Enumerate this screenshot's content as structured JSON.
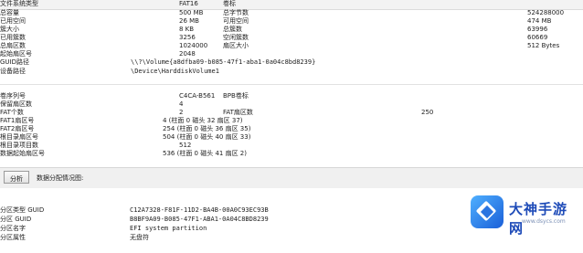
{
  "properties": [
    {
      "label": "文件系统类型",
      "value1": "FAT16",
      "label2": "卷标",
      "value2": ""
    },
    {
      "label": "总容量",
      "value1": "500 MB",
      "label2": "总字节数",
      "value2": "524288000"
    },
    {
      "label": "已用空间",
      "value1": "26 MB",
      "label2": "可用空间",
      "value2": "474 MB"
    },
    {
      "label": "簇大小",
      "value1": "8 KB",
      "label2": "总簇数",
      "value2": "63996"
    },
    {
      "label": "已用簇数",
      "value1": "3256",
      "label2": "空闲簇数",
      "value2": "60669"
    },
    {
      "label": "总扇区数",
      "value1": "1024000",
      "label2": "扇区大小",
      "value2": "512 Bytes"
    },
    {
      "label": "起始扇区号",
      "value1": "2048",
      "label2": "",
      "value2": ""
    },
    {
      "label": "GUID路径",
      "value1": "\\\\?\\Volume{a8dfba09-b085-47f1-aba1-0a04c8bd8239}",
      "label2": "",
      "value2": ""
    },
    {
      "label": "设备路径",
      "value1": "\\Device\\HarddiskVolume1",
      "label2": "",
      "value2": ""
    }
  ],
  "fat_info": [
    {
      "label": "卷序列号",
      "value1": "C4CA-B561",
      "label2": "BPB卷标",
      "value2": ""
    },
    {
      "label": "保留扇区数",
      "value1": "4",
      "label2": "",
      "value2": ""
    },
    {
      "label": "FAT个数",
      "value1": "2",
      "label2": "FAT扇区数",
      "value2": "250"
    },
    {
      "label": "FAT1扇区号",
      "value1": "4 (柱面 0 磁头 32 扇区 37)",
      "label2": "",
      "value2": ""
    },
    {
      "label": "FAT2扇区号",
      "value1": "254 (柱面 0 磁头 36 扇区 35)",
      "label2": "",
      "value2": ""
    },
    {
      "label": "根目录扇区号",
      "value1": "504 (柱面 0 磁头 40 扇区 33)",
      "label2": "",
      "value2": ""
    },
    {
      "label": "根目录项目数",
      "value1": "512",
      "label2": "",
      "value2": ""
    },
    {
      "label": "数据起始扇区号",
      "value1": "536 (柱面 0 磁头 41 扇区 2)",
      "label2": "",
      "value2": ""
    }
  ],
  "analyze": {
    "button_label": "分析",
    "label": "数据分配情况图:"
  },
  "partition": [
    {
      "label": "分区类型 GUID",
      "value": "C12A7328-F81F-11D2-BA4B-00A0C93EC93B"
    },
    {
      "label": "分区 GUID",
      "value": "B8BF9A09-B085-47F1-ABA1-0A04C8BD8239"
    },
    {
      "label": "分区名字",
      "value": "EFI system partition"
    },
    {
      "label": "分区属性",
      "value": "无盘符"
    }
  ],
  "watermark": {
    "title": "大神手游网",
    "url": "www.dsycs.com"
  }
}
